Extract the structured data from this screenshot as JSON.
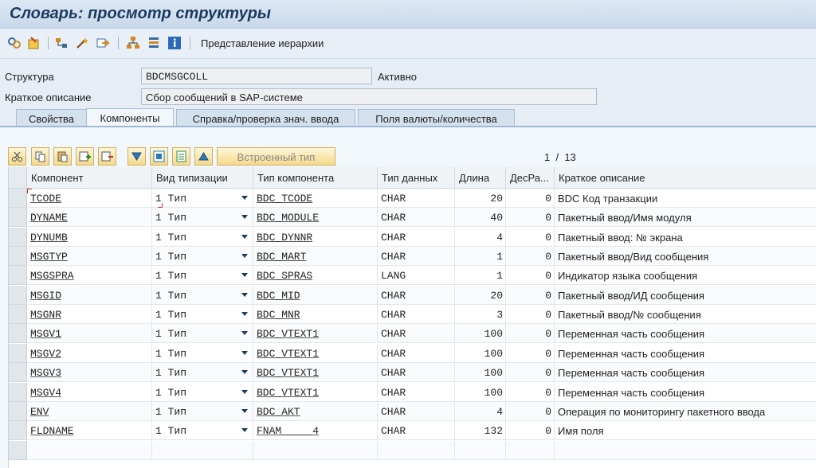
{
  "title": "Словарь: просмотр структуры",
  "toolbar": {
    "icons": [
      "other-object-icon",
      "display-change-icon",
      "where-used-icon",
      "wand-icon",
      "navigate-icon",
      "hierarchy-icon",
      "list-icon",
      "info-icon"
    ],
    "hierarchy_label": "Представление иерархии"
  },
  "fields": {
    "structure_label": "Структура",
    "structure_value": "BDCMSGCOLL",
    "structure_status": "Активно",
    "desc_label": "Краткое описание",
    "desc_value": "Сбор сообщений в SAP-системе"
  },
  "tabs": [
    {
      "label": "Свойства",
      "active": false
    },
    {
      "label": "Компоненты",
      "active": true
    },
    {
      "label": "Справка/проверка знач. ввода",
      "active": false
    },
    {
      "label": "Поля валюты/количества",
      "active": false
    }
  ],
  "grid_toolbar": {
    "builtin_type_label": "Встроенный тип",
    "page_current": "1",
    "page_sep": "/",
    "page_total": "13"
  },
  "table": {
    "columns": [
      "Компонент",
      "Вид типизации",
      "Тип компонента",
      "Тип данных",
      "Длина",
      "ДесРа...",
      "Краткое описание"
    ],
    "rows": [
      {
        "component": "TCODE",
        "typing": "1 Тип",
        "type": "BDC_TCODE",
        "dtype": "CHAR",
        "length": "20",
        "dec": "0",
        "desc": "BDC Код транзакции"
      },
      {
        "component": "DYNAME",
        "typing": "1 Тип",
        "type": "BDC_MODULE",
        "dtype": "CHAR",
        "length": "40",
        "dec": "0",
        "desc": "Пакетный ввод/Имя модуля"
      },
      {
        "component": "DYNUMB",
        "typing": "1 Тип",
        "type": "BDC_DYNNR",
        "dtype": "CHAR",
        "length": "4",
        "dec": "0",
        "desc": "Пакетный ввод: № экрана"
      },
      {
        "component": "MSGTYP",
        "typing": "1 Тип",
        "type": "BDC_MART",
        "dtype": "CHAR",
        "length": "1",
        "dec": "0",
        "desc": "Пакетный ввод/Вид сообщения"
      },
      {
        "component": "MSGSPRA",
        "typing": "1 Тип",
        "type": "BDC_SPRAS",
        "dtype": "LANG",
        "length": "1",
        "dec": "0",
        "desc": "Индикатор языка сообщения"
      },
      {
        "component": "MSGID",
        "typing": "1 Тип",
        "type": "BDC_MID",
        "dtype": "CHAR",
        "length": "20",
        "dec": "0",
        "desc": "Пакетный ввод/ИД сообщения"
      },
      {
        "component": "MSGNR",
        "typing": "1 Тип",
        "type": "BDC_MNR",
        "dtype": "CHAR",
        "length": "3",
        "dec": "0",
        "desc": "Пакетный ввод/№ сообщения"
      },
      {
        "component": "MSGV1",
        "typing": "1 Тип",
        "type": "BDC_VTEXT1",
        "dtype": "CHAR",
        "length": "100",
        "dec": "0",
        "desc": "Переменная часть сообщения"
      },
      {
        "component": "MSGV2",
        "typing": "1 Тип",
        "type": "BDC_VTEXT1",
        "dtype": "CHAR",
        "length": "100",
        "dec": "0",
        "desc": "Переменная часть сообщения"
      },
      {
        "component": "MSGV3",
        "typing": "1 Тип",
        "type": "BDC_VTEXT1",
        "dtype": "CHAR",
        "length": "100",
        "dec": "0",
        "desc": "Переменная часть сообщения"
      },
      {
        "component": "MSGV4",
        "typing": "1 Тип",
        "type": "BDC_VTEXT1",
        "dtype": "CHAR",
        "length": "100",
        "dec": "0",
        "desc": "Переменная часть сообщения"
      },
      {
        "component": "ENV",
        "typing": "1 Тип",
        "type": "BDC_AKT",
        "dtype": "CHAR",
        "length": "4",
        "dec": "0",
        "desc": "Операция по мониторингу пакетного ввода"
      },
      {
        "component": "FLDNAME",
        "typing": "1 Тип",
        "type": "FNAM_____4",
        "dtype": "CHAR",
        "length": "132",
        "dec": "0",
        "desc": "Имя поля"
      },
      {
        "component": "",
        "typing": "",
        "type": "",
        "dtype": "",
        "length": "",
        "dec": "",
        "desc": ""
      }
    ]
  }
}
